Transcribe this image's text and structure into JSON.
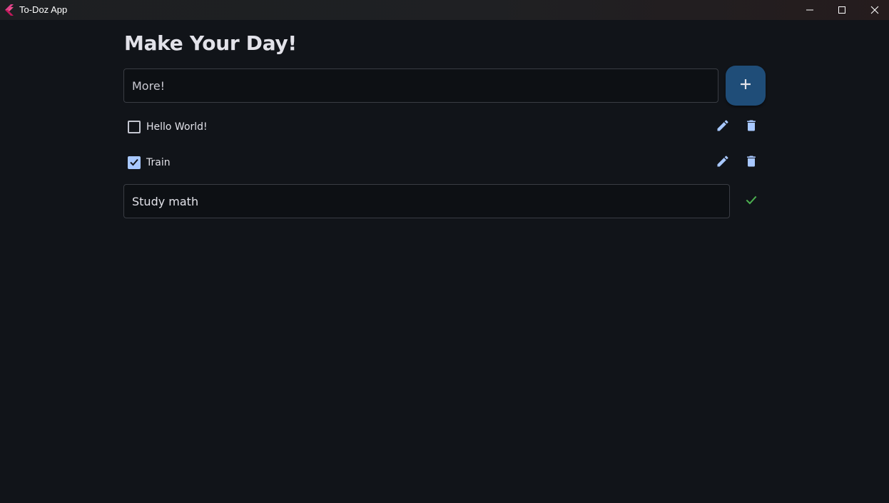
{
  "window": {
    "title": "To-Doz App",
    "logo_icon": "flutter-logo-icon",
    "controls": [
      "minimize-icon",
      "maximize-icon",
      "close-icon"
    ]
  },
  "main": {
    "heading": "Make Your Day!",
    "new_task_input": {
      "value": "More!"
    },
    "add_button_icon": "plus-icon"
  },
  "todos": [
    {
      "label": "Hello World!",
      "checked": false
    },
    {
      "label": "Train",
      "checked": true
    }
  ],
  "editing": {
    "value": "Study math",
    "confirm_icon": "check-icon"
  },
  "colors": {
    "background": "#111419",
    "accent": "#a8c8ff",
    "add_button": "#1f4d78",
    "confirm": "#4caf50"
  }
}
